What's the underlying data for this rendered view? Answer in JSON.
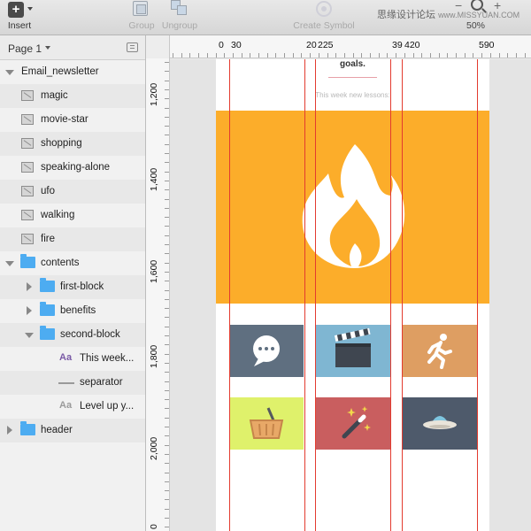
{
  "toolbar": {
    "insert": "Insert",
    "group": "Group",
    "ungroup": "Ungroup",
    "create_symbol": "Create Symbol",
    "zoom_value": "50%",
    "watermark_cn": "思缘设计论坛",
    "watermark_en": "www.MISSYUAN.COM"
  },
  "sidebar": {
    "page_label": "Page 1",
    "layers": {
      "root": "Email_newsletter",
      "magic": "magic",
      "movie_star": "movie-star",
      "shopping": "shopping",
      "speaking_alone": "speaking-alone",
      "ufo": "ufo",
      "walking": "walking",
      "fire": "fire",
      "contents": "contents",
      "first_block": "first-block",
      "benefits": "benefits",
      "second_block": "second-block",
      "this_week": "This week...",
      "separator": "separator",
      "level_up": "Level up y...",
      "header": "header"
    },
    "text_icon_glyph": "Aa"
  },
  "ruler": {
    "top": [
      "0",
      "30",
      "20",
      "225",
      "39",
      "420",
      "590"
    ],
    "left": [
      "1,200",
      "1,400",
      "1,600",
      "1,800",
      "2,000",
      "0"
    ]
  },
  "artboard": {
    "goals": "goals.",
    "week_text": "This week new lessons:"
  },
  "colors": {
    "hero": "#fcad2a",
    "guide": "#e33b2f",
    "folder": "#4dacf1",
    "tile_chat": "#5f6f80",
    "tile_movie": "#7fb6d2",
    "tile_walk": "#de9e62",
    "tile_basket": "#dff16b",
    "tile_magic": "#c95e5f",
    "tile_ufo": "#4e5a6b"
  },
  "icons": [
    "plus-icon",
    "group-icon",
    "ungroup-icon",
    "create-symbol-icon",
    "zoom-icon",
    "fire-icon",
    "chat-icon",
    "clapperboard-icon",
    "walking-icon",
    "basket-icon",
    "magic-wand-icon",
    "ufo-icon"
  ]
}
